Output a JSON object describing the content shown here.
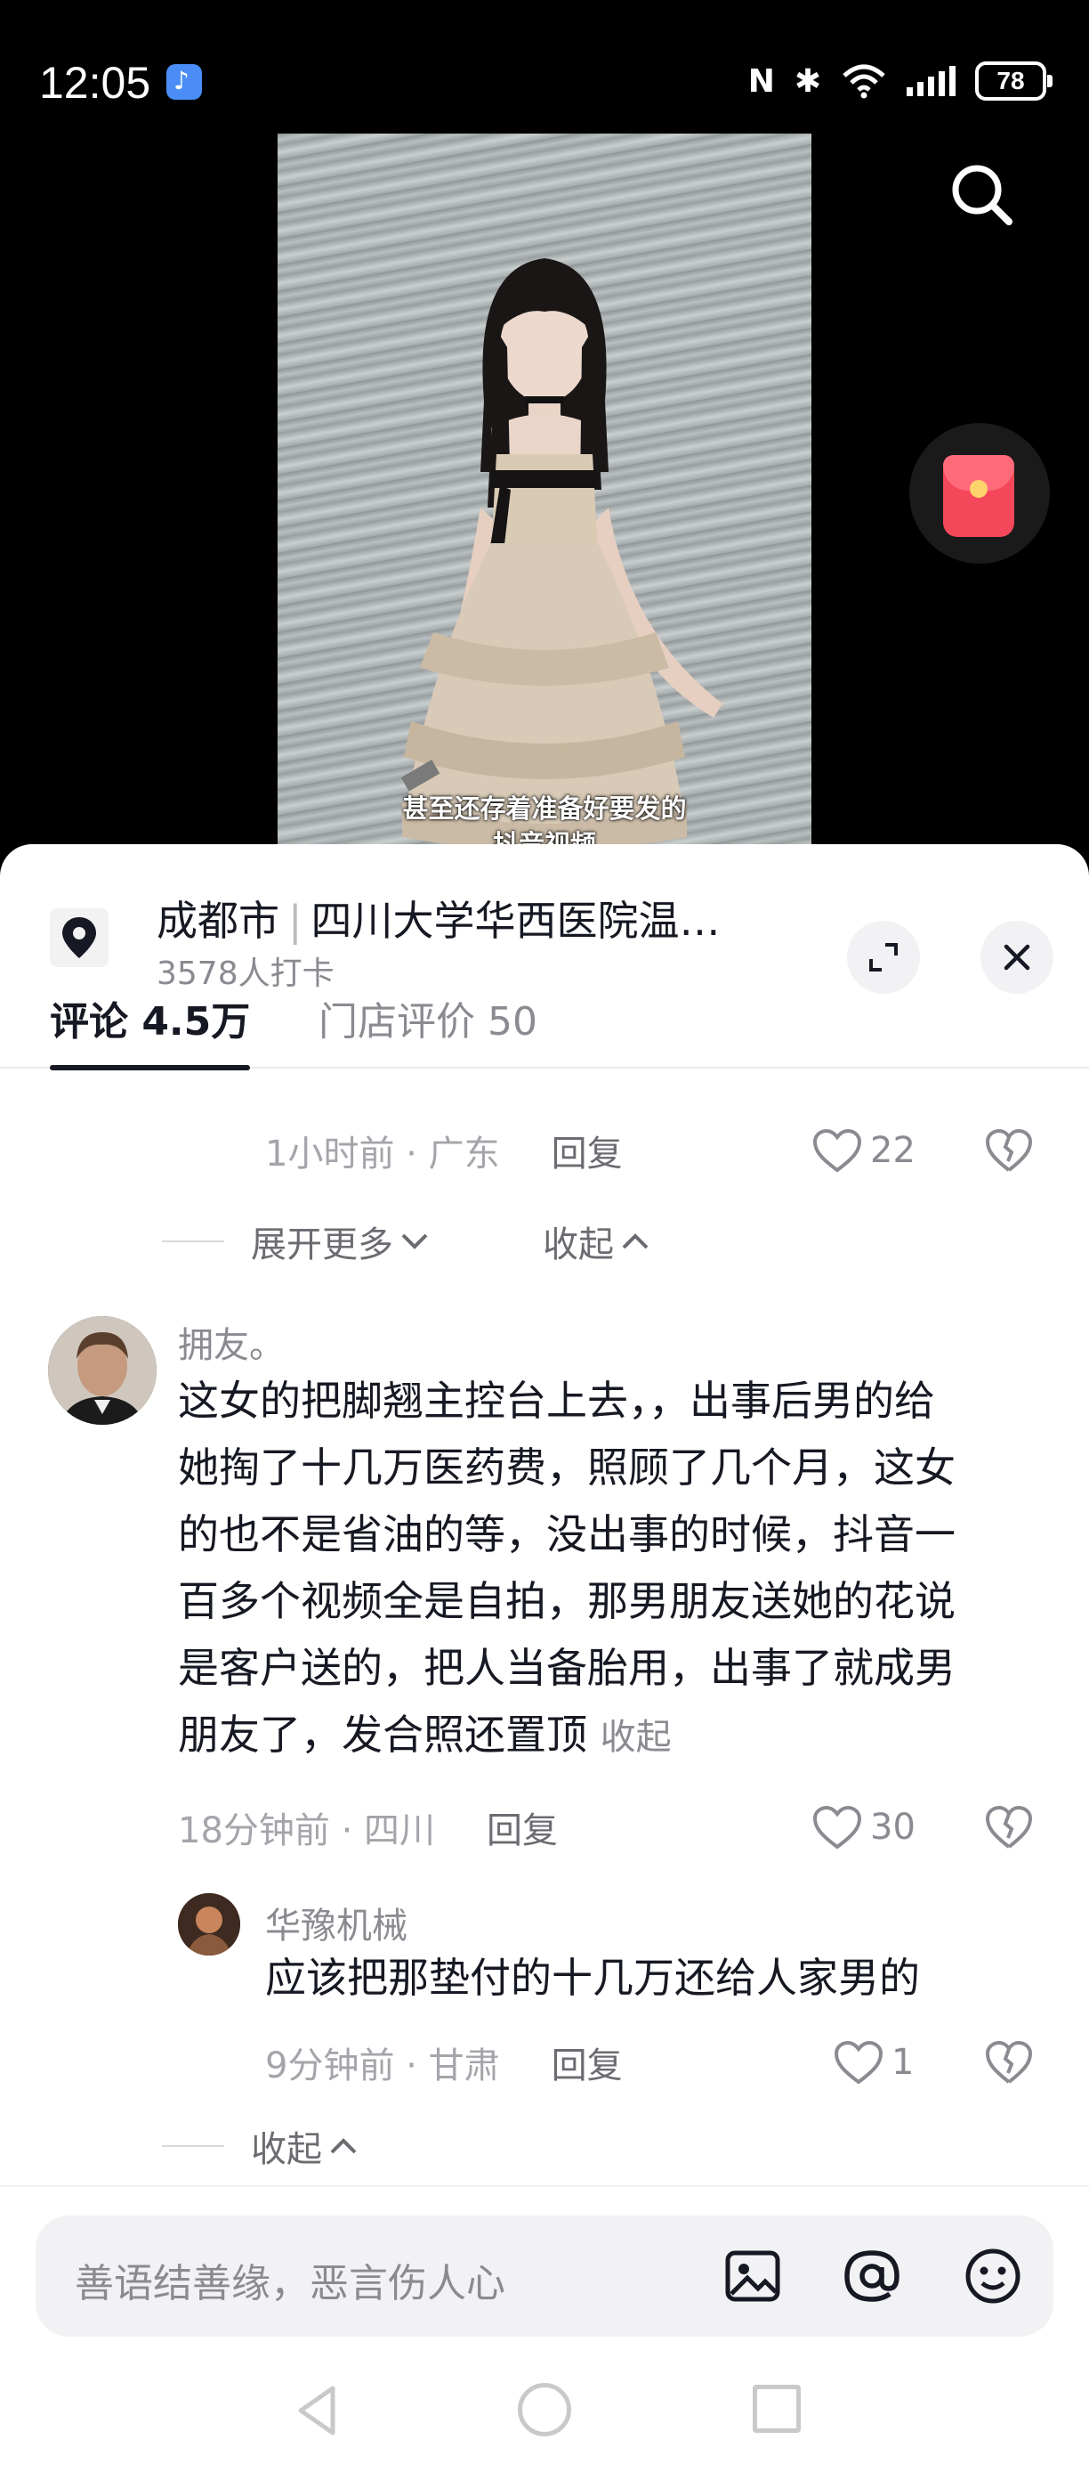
{
  "status_bar": {
    "time": "12:05",
    "battery": "78",
    "nfc": "N",
    "bluetooth": "✱"
  },
  "video": {
    "caption_line1": "甚至还存着准备好要发的",
    "caption_line2": "抖音视频"
  },
  "location": {
    "city": "成都市",
    "separator": "|",
    "place": "四川大学华西医院温…",
    "checkins": "3578人打卡"
  },
  "tabs": {
    "comments": "评论 4.5万",
    "reviews": "门店评价 50"
  },
  "prev_comment": {
    "time_loc": "1小时前 · 广东",
    "reply": "回复",
    "likes": "22"
  },
  "prev_folds": {
    "expand": "展开更多",
    "collapse": "收起"
  },
  "main_comment": {
    "username": "拥友。",
    "lines": [
      "这女的把脚翘主控台上去，，出事后男的给",
      "她掏了十几万医药费，照顾了几个月，这女",
      "的也不是省油的等，没出事的时候，抖音一",
      "百多个视频全是自拍，那男朋友送她的花说",
      "是客户送的，把人当备胎用，出事了就成男",
      "朋友了，发合照还置顶"
    ],
    "collapse_link": "收起",
    "time_loc": "18分钟前 · 四川",
    "reply": "回复",
    "likes": "30"
  },
  "reply_comment": {
    "username": "华豫机械",
    "text": "应该把那垫付的十几万还给人家男的",
    "time_loc": "9分钟前 · 甘肃",
    "reply": "回复",
    "likes": "1"
  },
  "reply_fold": {
    "collapse": "收起"
  },
  "input": {
    "placeholder": "善语结善缘，恶言伤人心"
  },
  "icons": {
    "search": "search-icon",
    "red_packet": "red-packet-icon",
    "location_pin": "pin-icon",
    "expand": "expand-icon",
    "close": "close-icon",
    "heart": "heart-icon",
    "dislike": "broken-heart-icon",
    "image": "image-icon",
    "mention": "at-icon",
    "emoji": "emoji-icon"
  }
}
